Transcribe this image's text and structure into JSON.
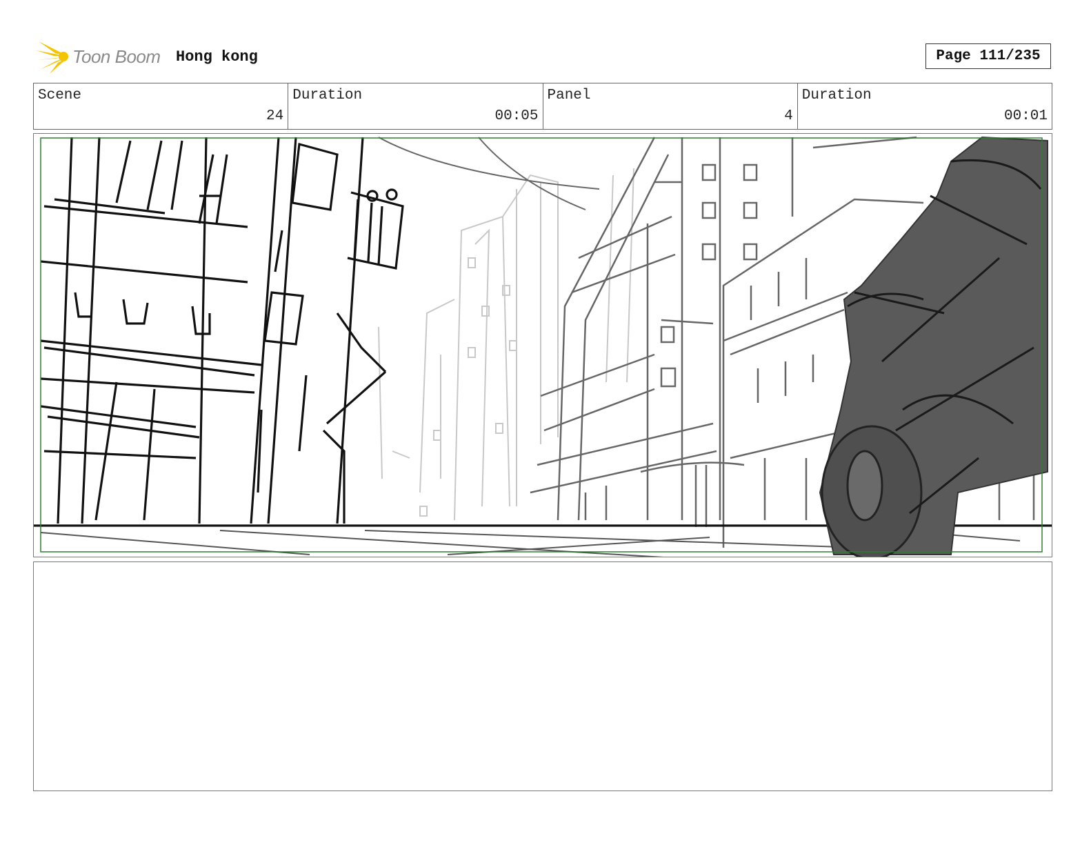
{
  "header": {
    "logo_text": "Toon Boom",
    "project_title": "Hong kong",
    "page_label": "Page 111/235"
  },
  "info": {
    "scene_label": "Scene",
    "scene_value": "24",
    "scene_duration_label": "Duration",
    "scene_duration_value": "00:05",
    "panel_label": "Panel",
    "panel_value": "4",
    "panel_duration_label": "Duration",
    "panel_duration_value": "00:01"
  },
  "notes": {
    "text": ""
  },
  "colors": {
    "logo_accent": "#f5c400",
    "safe_frame": "#2e7d32",
    "vehicle_fill": "#5a5a5a"
  },
  "icons": {
    "logo": "toon-boom-sun-icon"
  }
}
